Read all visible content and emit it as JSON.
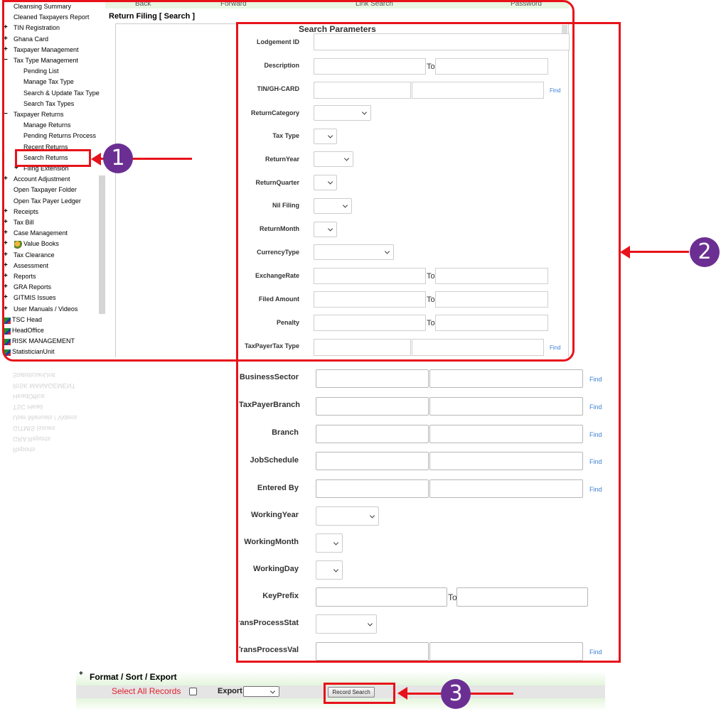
{
  "topnav": {
    "back": "Back",
    "forward": "Forward",
    "link_search": "Link Search",
    "password": "Password"
  },
  "sidebar": {
    "items": [
      {
        "label": "Cleansing Summary",
        "plus": "",
        "indent": 1
      },
      {
        "label": "Cleaned Taxpayers Report",
        "plus": "",
        "indent": 1
      },
      {
        "label": "TIN Registration",
        "plus": "+",
        "indent": 1
      },
      {
        "label": "Ghana Card",
        "plus": "+",
        "indent": 1
      },
      {
        "label": "Taxpayer Management",
        "plus": "+",
        "indent": 1
      },
      {
        "label": "Tax Type Management",
        "plus": "−",
        "indent": 1
      },
      {
        "label": "Pending  List",
        "plus": "",
        "indent": 2
      },
      {
        "label": "Manage Tax Type",
        "plus": "",
        "indent": 2
      },
      {
        "label": "Search & Update Tax Type",
        "plus": "",
        "indent": 2
      },
      {
        "label": "Search Tax Types",
        "plus": "",
        "indent": 2
      },
      {
        "label": "Taxpayer Returns",
        "plus": "−",
        "indent": 1
      },
      {
        "label": "Manage Returns",
        "plus": "",
        "indent": 2
      },
      {
        "label": "Pending Returns Process",
        "plus": "",
        "indent": 2
      },
      {
        "label": "Recent Returns",
        "plus": "",
        "indent": 2
      },
      {
        "label": "Search Returns",
        "plus": "",
        "indent": 2
      },
      {
        "label": "Filing Extension",
        "plus": "+",
        "indent": 3
      },
      {
        "label": "Account Adjustment",
        "plus": "+",
        "indent": 1
      },
      {
        "label": "Open Taxpayer Folder",
        "plus": "",
        "indent": 1
      },
      {
        "label": "Open Tax Payer Ledger",
        "plus": "",
        "indent": 1
      },
      {
        "label": "Receipts",
        "plus": "+",
        "indent": 1
      },
      {
        "label": "Tax Bill",
        "plus": "+",
        "indent": 1
      },
      {
        "label": "Case Management",
        "plus": "+",
        "indent": 1
      },
      {
        "label": "Value Books",
        "plus": "+",
        "indent": 4
      },
      {
        "label": "Tax Clearance",
        "plus": "+",
        "indent": 1
      },
      {
        "label": "Assessment",
        "plus": "+",
        "indent": 1
      },
      {
        "label": "Reports",
        "plus": "+",
        "indent": 1
      },
      {
        "label": "GRA Reports",
        "plus": "+",
        "indent": 1
      },
      {
        "label": "GITMIS Issues",
        "plus": "+",
        "indent": 1
      },
      {
        "label": "User Manuals / Videos",
        "plus": "+",
        "indent": 1
      },
      {
        "label": "TSC Head",
        "plus": "",
        "indent": 0
      },
      {
        "label": "HeadOffice",
        "plus": "",
        "indent": 0
      },
      {
        "label": "RISK MANAGEMENT",
        "plus": "",
        "indent": 0
      },
      {
        "label": "StatisticianUnit",
        "plus": "",
        "indent": 0
      }
    ]
  },
  "page": {
    "title": "Return Filing [ Search ]",
    "panel_title": "Search Parameters"
  },
  "form": {
    "lodgement_id": "Lodgement ID",
    "description": "Description",
    "tin": "TIN/GH-CARD",
    "return_category": "ReturnCategory",
    "tax_type": "Tax Type",
    "return_year": "ReturnYear",
    "return_quarter": "ReturnQuarter",
    "nil_filing": "Nil Filing",
    "return_month": "ReturnMonth",
    "currency_type": "CurrencyType",
    "exchange_rate": "ExchangeRate",
    "filed_amount": "Filed Amount",
    "penalty": "Penalty",
    "taxpayer_tax_type": "TaxPayerTax Type",
    "business_sector": "BusinessSector",
    "taxpayer_branch": "TaxPayerBranch",
    "branch": "Branch",
    "job_schedule": "JobSchedule",
    "entered_by": "Entered By",
    "working_year": "WorkingYear",
    "working_month": "WorkingMonth",
    "working_day": "WorkingDay",
    "key_prefix": "KeyPrefix",
    "trans_process_stat": "TransProcessStat",
    "trans_process_val": "TransProcessVal",
    "to": "To",
    "find": "Find"
  },
  "bottom": {
    "section_title": "Format / Sort / Export",
    "plus": "+",
    "select_all": "Select All Records",
    "export": "Export",
    "record_search": "Record Search"
  },
  "annotations": {
    "one": "1",
    "two": "2",
    "three": "3"
  },
  "colors": {
    "annotation_red": "#e8121a",
    "badge_purple": "#6b2f93",
    "find_link": "#3d7fd6",
    "select_all": "#e0202a"
  }
}
